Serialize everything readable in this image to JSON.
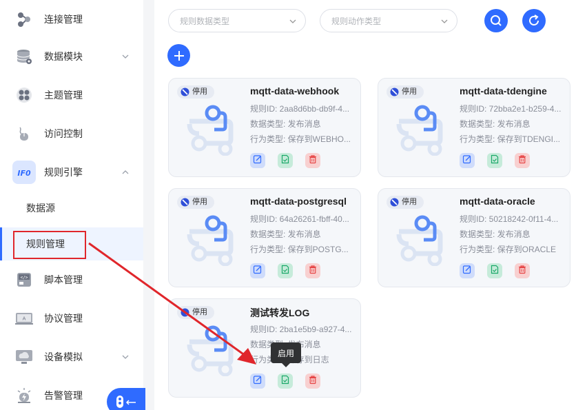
{
  "sidebar": {
    "items": [
      {
        "label": "连接管理",
        "icon": "connection-icon"
      },
      {
        "label": "数据模块",
        "icon": "database-icon",
        "expandable": true
      },
      {
        "label": "主题管理",
        "icon": "topic-icon"
      },
      {
        "label": "访问控制",
        "icon": "access-control-icon"
      },
      {
        "label": "规则引擎",
        "icon": "rule-engine-icon",
        "expandable": true,
        "expanded": true
      },
      {
        "label": "脚本管理",
        "icon": "script-icon"
      },
      {
        "label": "协议管理",
        "icon": "protocol-icon"
      },
      {
        "label": "设备模拟",
        "icon": "device-sim-icon",
        "expandable": true
      },
      {
        "label": "告警管理",
        "icon": "alarm-icon"
      }
    ],
    "subitems": [
      {
        "label": "数据源",
        "selected": false
      },
      {
        "label": "规则管理",
        "selected": true
      }
    ]
  },
  "toolbar": {
    "data_type_placeholder": "规则数据类型",
    "action_type_placeholder": "规则动作类型"
  },
  "cards": [
    {
      "badge": "停用",
      "title": "mqtt-data-webhook",
      "rule_id": "规则ID: 2aa8d6bb-db9f-4...",
      "data_type": "数据类型: 发布消息",
      "action_type": "行为类型: 保存到WEBHO..."
    },
    {
      "badge": "停用",
      "title": "mqtt-data-tdengine",
      "rule_id": "规则ID: 72bba2e1-b259-4...",
      "data_type": "数据类型: 发布消息",
      "action_type": "行为类型: 保存到TDENGI..."
    },
    {
      "badge": "停用",
      "title": "mqtt-data-postgresql",
      "rule_id": "规则ID: 64a26261-fbff-40...",
      "data_type": "数据类型: 发布消息",
      "action_type": "行为类型: 保存到POSTG..."
    },
    {
      "badge": "停用",
      "title": "mqtt-data-oracle",
      "rule_id": "规则ID: 50218242-0f11-4...",
      "data_type": "数据类型: 发布消息",
      "action_type": "行为类型: 保存到ORACLE"
    },
    {
      "badge": "停用",
      "title": "测试转发LOG",
      "rule_id": "规则ID: 2ba1e5b9-a927-4...",
      "data_type": "数据类型: 发布消息",
      "action_type": "行为类型: 保存到日志"
    }
  ],
  "tooltip": {
    "text": "启用"
  },
  "colors": {
    "primary": "#2f6bff",
    "annotation_red": "#e0262b",
    "edit_bg": "#cfdcfb",
    "enable_bg": "#c6ebda",
    "delete_bg": "#f8d0d0"
  }
}
